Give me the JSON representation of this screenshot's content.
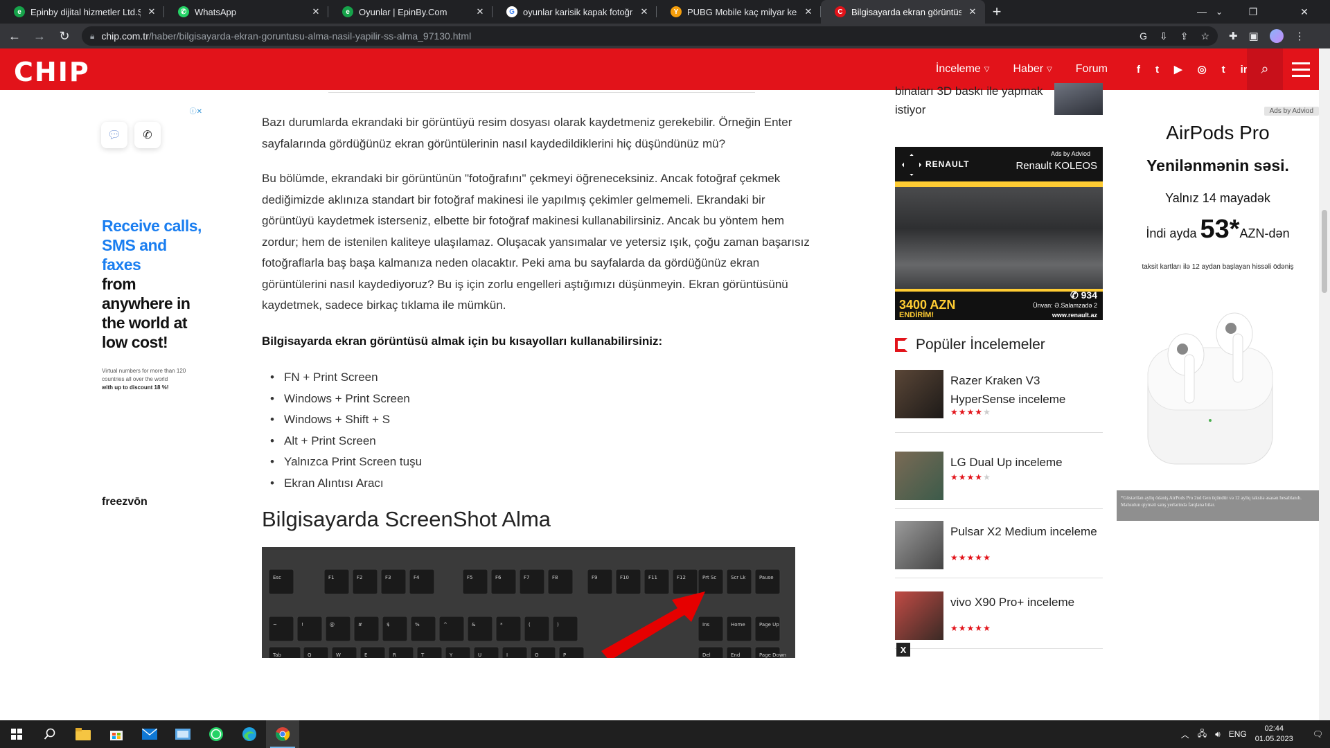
{
  "browser": {
    "tabs": [
      {
        "title": "Epinby dijital hizmetler Ltd.Şti | A",
        "favicon_color": "#16a34a",
        "favicon_glyph": "e"
      },
      {
        "title": "WhatsApp",
        "favicon_color": "#25d366",
        "favicon_glyph": "✆"
      },
      {
        "title": "Oyunlar | EpinBy.Com",
        "favicon_color": "#16a34a",
        "favicon_glyph": "e"
      },
      {
        "title": "oyunlar karisik kapak fotoğrafları",
        "favicon_color": "#ffffff",
        "favicon_glyph": "G"
      },
      {
        "title": "PUBG Mobile kaç milyar kez oyna",
        "favicon_color": "#f59e0b",
        "favicon_glyph": "Y"
      },
      {
        "title": "Bilgisayarda ekran görüntüsü alm",
        "favicon_color": "#e2131a",
        "favicon_glyph": "C"
      }
    ],
    "url_host": "chip.com.tr",
    "url_path": "/haber/bilgisayarda-ekran-goruntusu-alma-nasil-yapilir-ss-alma_97130.html"
  },
  "header": {
    "logo": "CHIP",
    "nav": [
      {
        "label": "İnceleme",
        "has_dropdown": true
      },
      {
        "label": "Haber",
        "has_dropdown": true
      },
      {
        "label": "Forum",
        "has_dropdown": false
      }
    ],
    "social": [
      "f",
      "t",
      "▶",
      "◎",
      "t",
      "in"
    ]
  },
  "left_ad": {
    "adchoice": "ⓘ✕",
    "headline_blue": "Receive calls, SMS and faxes",
    "headline_black": "from anywhere in the world at low cost!",
    "small_text": "Virtual numbers for more than 120 countries all over the world",
    "small_bold": "with up to discount 18 %!",
    "brand": "freezvōn"
  },
  "article": {
    "p1": "Bazı durumlarda ekrandaki bir görüntüyü resim dosyası olarak kaydetmeniz gerekebilir. Örneğin Enter sayfalarında gördüğünüz ekran görüntülerinin nasıl kaydedildiklerini hiç düşündünüz mü?",
    "p2": "Bu bölümde, ekrandaki bir görüntünün \"fotoğrafını\" çekmeyi öğreneceksiniz. Ancak fotoğraf çekmek dediğimizde aklınıza standart bir fotoğraf makinesi ile yapılmış çekimler gelmemeli. Ekrandaki bir görüntüyü kaydetmek isterseniz, elbette bir fotoğraf makinesi kullanabilirsiniz. Ancak bu yöntem hem zordur; hem de istenilen kaliteye ulaşılamaz. Oluşacak yansımalar ve yetersiz ışık, çoğu zaman başarısız fotoğraflarla baş başa kalmanıza neden olacaktır. Peki ama bu sayfalarda da gördüğünüz ekran görüntülerini nasıl kaydediyoruz? Bu iş için zorlu engelleri aştığımızı düşünmeyin. Ekran görüntüsünü kaydetmek, sadece birkaç tıklama ile mümkün.",
    "p3": "Bilgisayarda ekran görüntüsü almak için bu kısayolları kullanabilirsiniz:",
    "shortcuts": [
      "FN + Print Screen",
      "Windows + Print Screen",
      "Windows + Shift + S",
      "Alt + Print Screen",
      "Yalnızca Print Screen tuşu",
      "Ekran Alıntısı Aracı"
    ],
    "h2": "Bilgisayarda ScreenShot Alma",
    "keyboard_keys_row1": [
      "Esc",
      "F1",
      "F2",
      "F3",
      "F4",
      "F5",
      "F6",
      "F7",
      "F8",
      "F9",
      "F10",
      "F11",
      "F12",
      "Prt Sc",
      "Scr Lk",
      "Pause"
    ],
    "keyboard_keys_row2": [
      "~",
      "!",
      "@",
      "#",
      "$",
      "%",
      "^",
      "&",
      "*",
      "(",
      ")",
      "Ins",
      "Home",
      "Page Up"
    ],
    "keyboard_keys_row3": [
      "Tab",
      "Q",
      "W",
      "E",
      "R",
      "T",
      "Y",
      "U",
      "I",
      "O",
      "P",
      "Del",
      "End",
      "Page Down"
    ]
  },
  "sidebar": {
    "top_text": "binaları 3D baskı ile yapmak istiyor",
    "renault": {
      "brand": "RENAULT",
      "adsby": "Ads by Adviod",
      "model": "Renault KOLEOS",
      "price": "3400 AZN",
      "discount": "ENDİRİM!",
      "phone": "934",
      "address": "Ünvan: Ə.Salamzadə 2",
      "web": "www.renault.az"
    },
    "popular_title": "Popüler İncelemeler",
    "popular": [
      {
        "name": "Razer Kraken V3 HyperSense inceleme",
        "rating": 4
      },
      {
        "name": "LG Dual Up inceleme",
        "rating": 4
      },
      {
        "name": "Pulsar X2 Medium inceleme",
        "rating": 5
      },
      {
        "name": "vivo X90 Pro+ inceleme",
        "rating": 5
      }
    ],
    "close_label": "X"
  },
  "airpods_ad": {
    "adsby": "Ads by Adviod",
    "product": "AirPods Pro",
    "slogan": "Yenilənmənin səsi.",
    "date": "Yalnız 14 mayadək",
    "price_prefix": "İndi ayda",
    "price_big": "53*",
    "price_suffix": "AZN-dən",
    "terms": "taksit kartları ilə 12 aydan başlayan hissəli ödəniş",
    "footer": "*Göstərilən ayliq ödəniş AirPods Pro 2nd Gen üçündür və 12 ayliq taksitə əsasən hesablanıb. Məhsulun qiyməti satış yerlərində fərqlənə bilər."
  },
  "taskbar": {
    "lang": "ENG",
    "time": "02:44",
    "date": "01.05.2023"
  }
}
